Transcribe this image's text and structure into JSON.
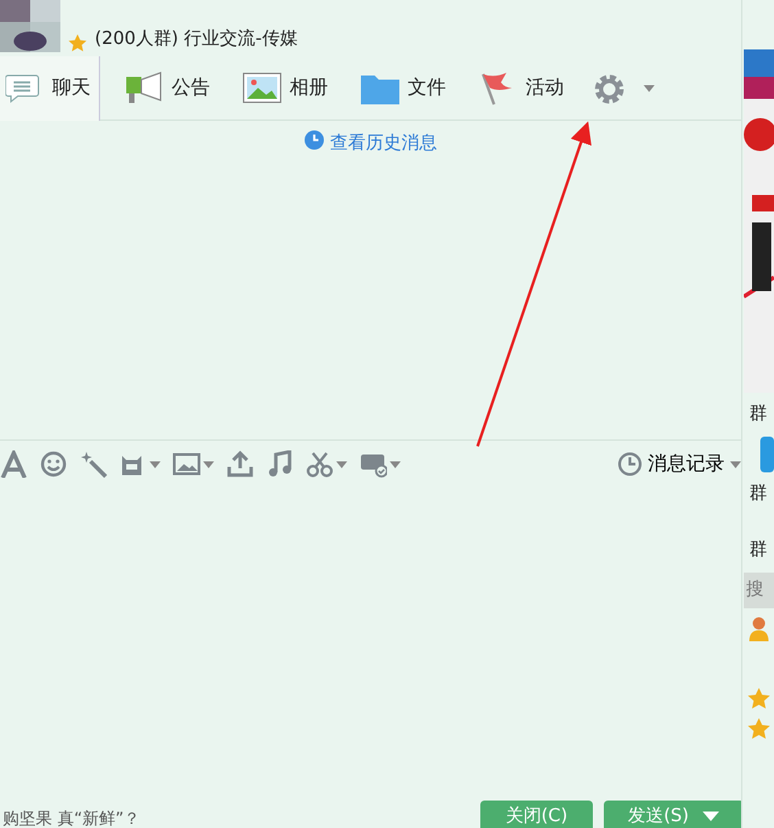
{
  "header": {
    "title": "(200人群) 行业交流-传媒",
    "starred": true
  },
  "tabs": [
    {
      "label": "聊天",
      "kind": "chat",
      "selected": true
    },
    {
      "label": "公告",
      "kind": "notice",
      "selected": false
    },
    {
      "label": "相册",
      "kind": "album",
      "selected": false
    },
    {
      "label": "文件",
      "kind": "files",
      "selected": false
    },
    {
      "label": "活动",
      "kind": "event",
      "selected": false
    }
  ],
  "history_link": "查看历史消息",
  "toolbar": {
    "tools": [
      {
        "kind": "font",
        "dropdown": false
      },
      {
        "kind": "emoji",
        "dropdown": false
      },
      {
        "kind": "effect",
        "dropdown": false
      },
      {
        "kind": "sticker",
        "dropdown": true
      },
      {
        "kind": "picture",
        "dropdown": true
      },
      {
        "kind": "upload",
        "dropdown": false
      },
      {
        "kind": "music",
        "dropdown": false
      },
      {
        "kind": "screenshot",
        "dropdown": true
      },
      {
        "kind": "remote",
        "dropdown": true
      }
    ],
    "history_button": "消息记录"
  },
  "footer": {
    "ticker": "购坚果 真“新鲜”？",
    "buttons": [
      {
        "label": "关闭(C)",
        "dropdown": false
      },
      {
        "label": "发送(S)",
        "dropdown": true
      }
    ]
  },
  "side": {
    "labels": [
      "群",
      "群",
      "群"
    ],
    "search_placeholder": "搜"
  }
}
